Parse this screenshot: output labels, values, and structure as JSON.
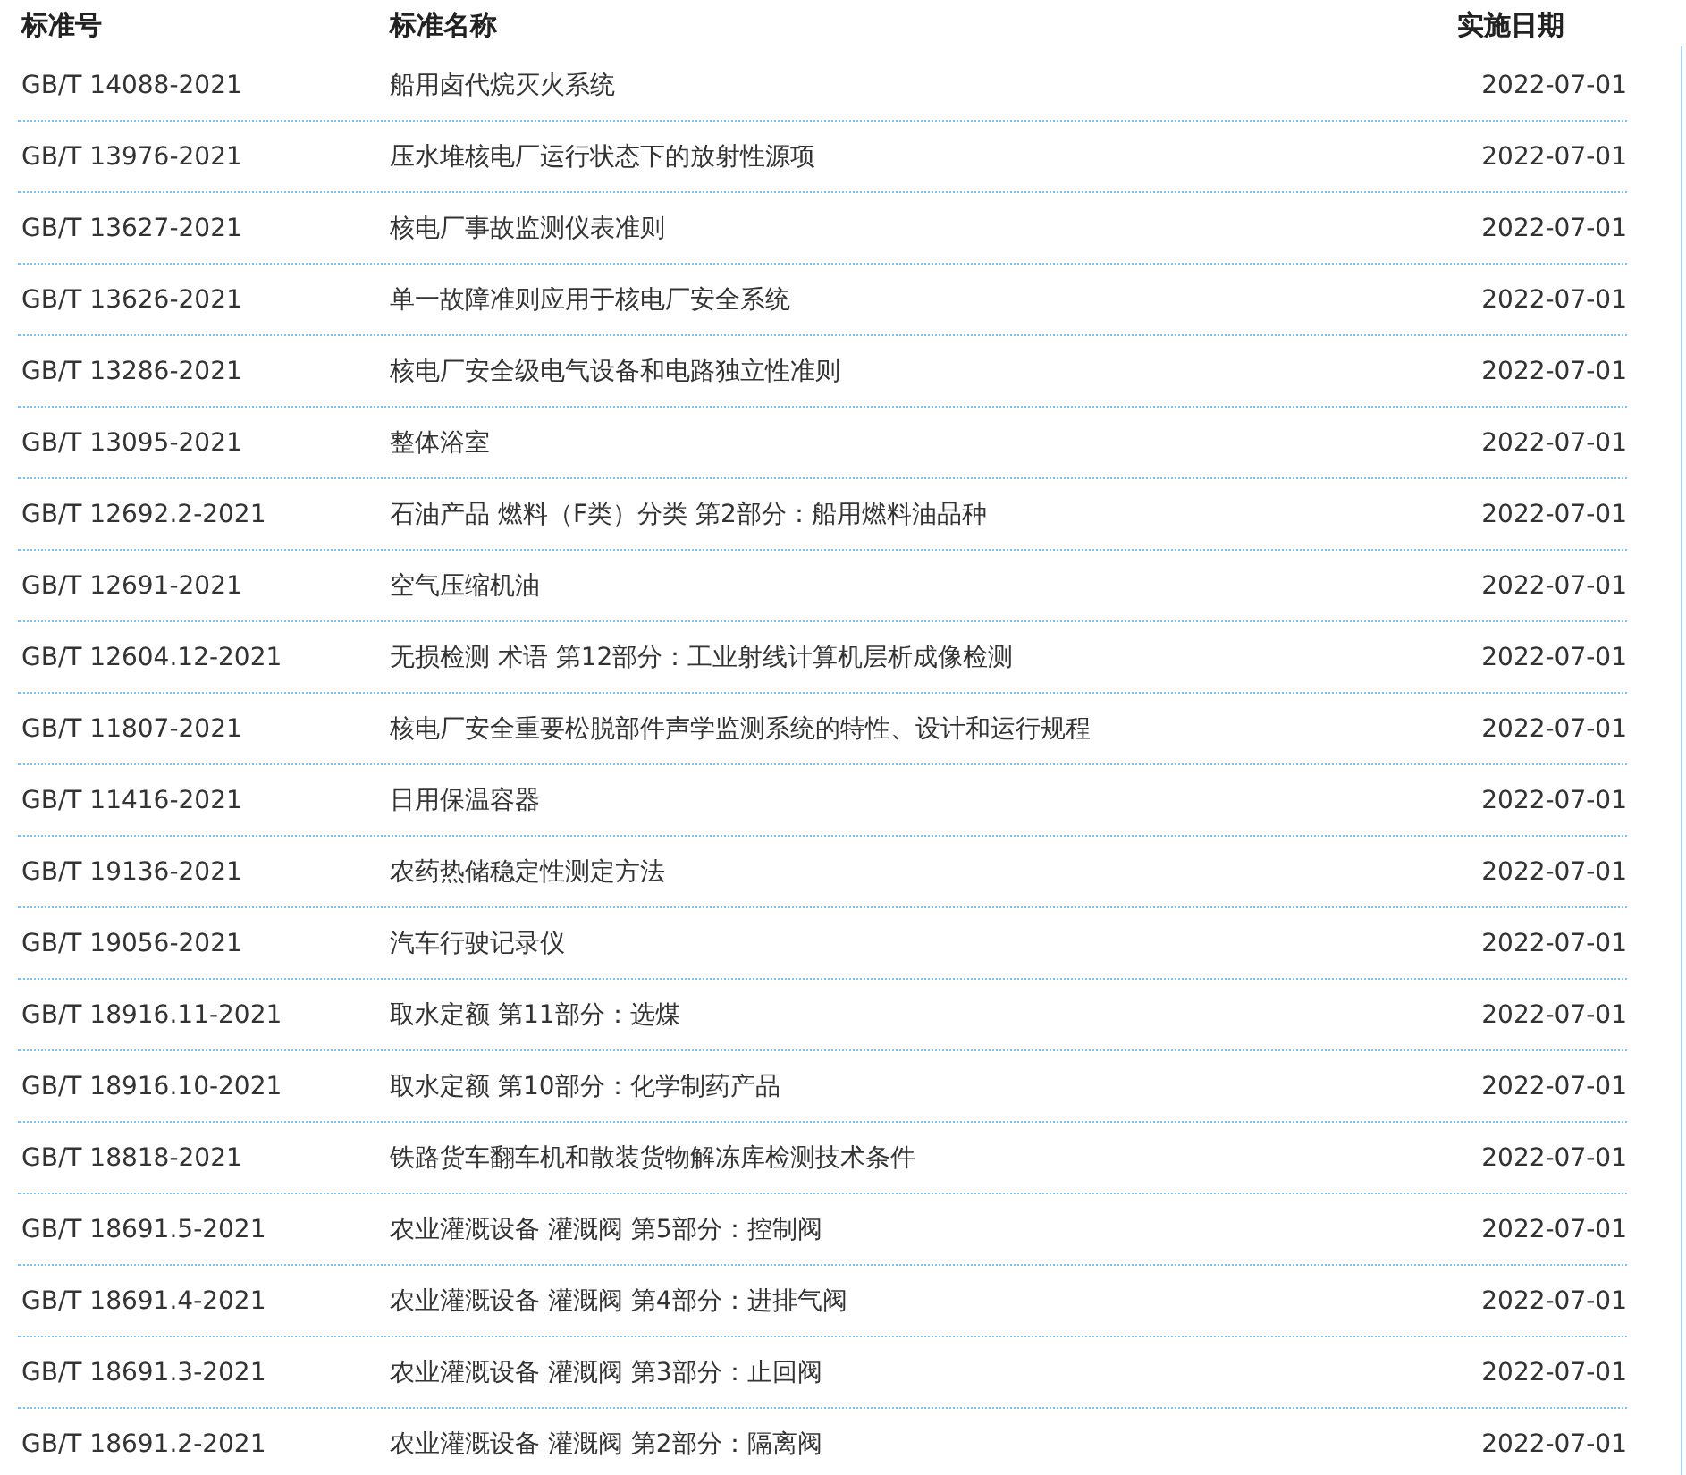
{
  "table": {
    "columns": [
      "标准号",
      "标准名称",
      "实施日期"
    ],
    "rows": [
      [
        "GB/T 14088-2021",
        "船用卤代烷灭火系统",
        "2022-07-01"
      ],
      [
        "GB/T 13976-2021",
        "压水堆核电厂运行状态下的放射性源项",
        "2022-07-01"
      ],
      [
        "GB/T 13627-2021",
        "核电厂事故监测仪表准则",
        "2022-07-01"
      ],
      [
        "GB/T 13626-2021",
        "单一故障准则应用于核电厂安全系统",
        "2022-07-01"
      ],
      [
        "GB/T 13286-2021",
        "核电厂安全级电气设备和电路独立性准则",
        "2022-07-01"
      ],
      [
        "GB/T 13095-2021",
        "整体浴室",
        "2022-07-01"
      ],
      [
        "GB/T 12692.2-2021",
        "石油产品 燃料（F类）分类 第2部分：船用燃料油品种",
        "2022-07-01"
      ],
      [
        "GB/T 12691-2021",
        "空气压缩机油",
        "2022-07-01"
      ],
      [
        "GB/T 12604.12-2021",
        "无损检测 术语 第12部分：工业射线计算机层析成像检测",
        "2022-07-01"
      ],
      [
        "GB/T 11807-2021",
        "核电厂安全重要松脱部件声学监测系统的特性、设计和运行规程",
        "2022-07-01"
      ],
      [
        "GB/T 11416-2021",
        "日用保温容器",
        "2022-07-01"
      ],
      [
        "GB/T 19136-2021",
        "农药热储稳定性测定方法",
        "2022-07-01"
      ],
      [
        "GB/T 19056-2021",
        "汽车行驶记录仪",
        "2022-07-01"
      ],
      [
        "GB/T 18916.11-2021",
        "取水定额 第11部分：选煤",
        "2022-07-01"
      ],
      [
        "GB/T 18916.10-2021",
        "取水定额 第10部分：化学制药产品",
        "2022-07-01"
      ],
      [
        "GB/T 18818-2021",
        "铁路货车翻车机和散装货物解冻库检测技术条件",
        "2022-07-01"
      ],
      [
        "GB/T 18691.5-2021",
        "农业灌溉设备 灌溉阀 第5部分：控制阀",
        "2022-07-01"
      ],
      [
        "GB/T 18691.4-2021",
        "农业灌溉设备 灌溉阀 第4部分：进排气阀",
        "2022-07-01"
      ],
      [
        "GB/T 18691.3-2021",
        "农业灌溉设备 灌溉阀 第3部分：止回阀",
        "2022-07-01"
      ],
      [
        "GB/T 18691.2-2021",
        "农业灌溉设备 灌溉阀 第2部分：隔离阀",
        "2022-07-01"
      ]
    ]
  }
}
